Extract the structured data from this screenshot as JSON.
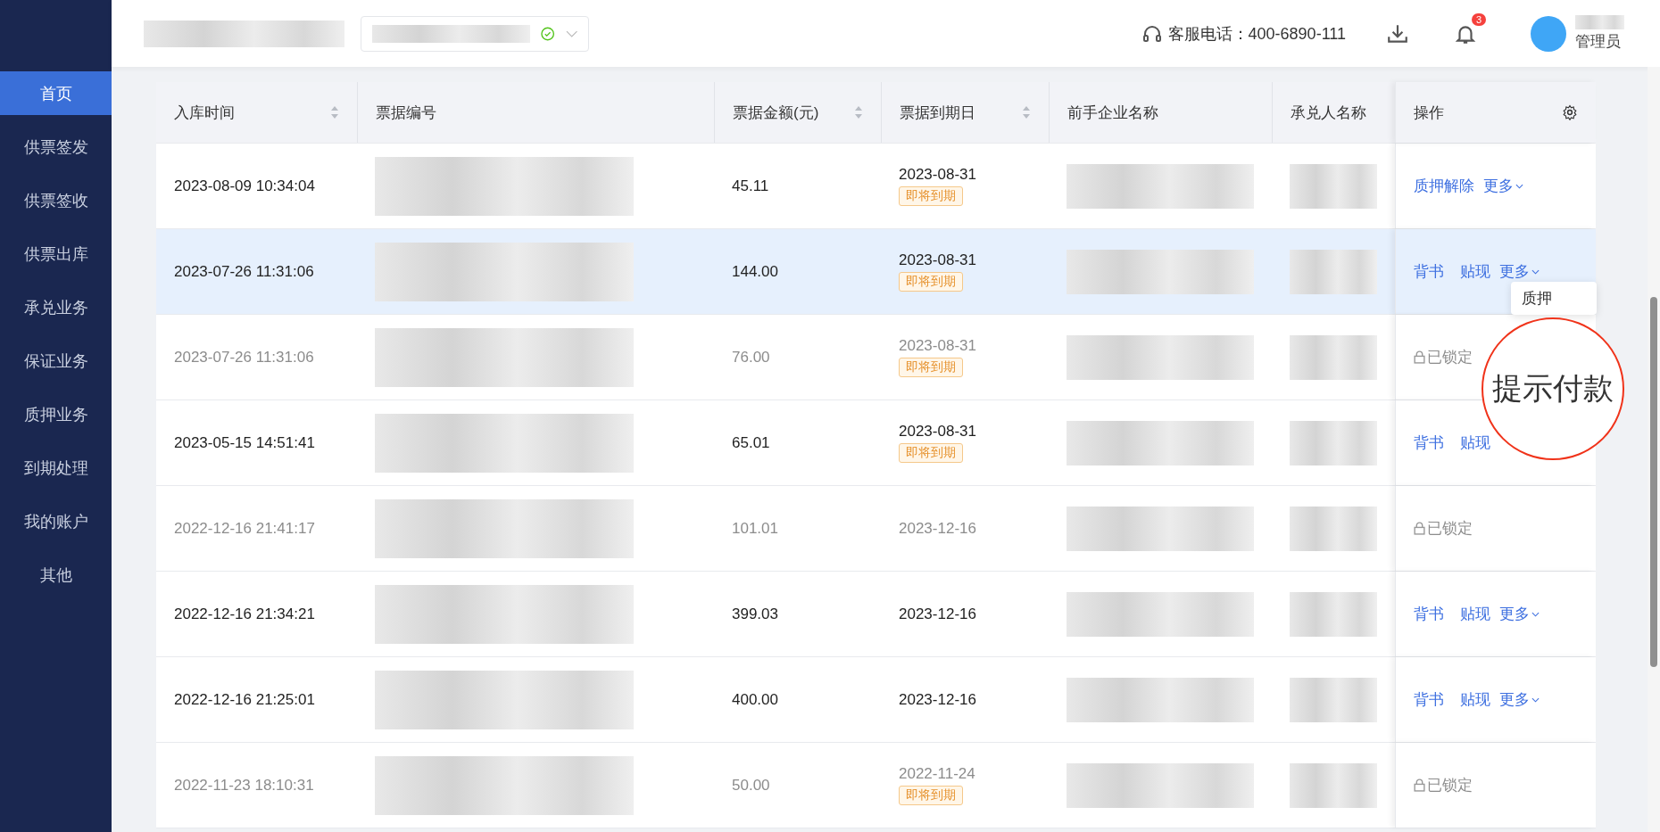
{
  "header": {
    "phone_label": "客服电话：400-6890-111",
    "notification_count": "3",
    "user_role": "管理员"
  },
  "sidebar": {
    "items": [
      {
        "label": "首页",
        "selected": true
      },
      {
        "label": "供票签发",
        "selected": false
      },
      {
        "label": "供票签收",
        "selected": false
      },
      {
        "label": "供票出库",
        "selected": false
      },
      {
        "label": "承兑业务",
        "selected": false
      },
      {
        "label": "保证业务",
        "selected": false
      },
      {
        "label": "质押业务",
        "selected": false
      },
      {
        "label": "到期处理",
        "selected": false
      },
      {
        "label": "我的账户",
        "selected": false
      },
      {
        "label": "其他",
        "selected": false
      }
    ]
  },
  "table": {
    "columns": [
      {
        "label": "入库时间",
        "sortable": true
      },
      {
        "label": "票据编号",
        "sortable": false
      },
      {
        "label": "票据金额(元)",
        "sortable": true
      },
      {
        "label": "票据到期日",
        "sortable": true
      },
      {
        "label": "前手企业名称",
        "sortable": false
      },
      {
        "label": "承兑人名称",
        "sortable": false
      },
      {
        "label": "操作",
        "sortable": false
      }
    ],
    "rows": [
      {
        "time": "2023-08-09 10:34:04",
        "amount": "45.11",
        "due": "2023-08-31",
        "badge": "即将到期",
        "locked": false,
        "selected": false,
        "actions": [
          "质押解除"
        ],
        "more": "更多"
      },
      {
        "time": "2023-07-26 11:31:06",
        "amount": "144.00",
        "due": "2023-08-31",
        "badge": "即将到期",
        "locked": false,
        "selected": true,
        "actions": [
          "背书",
          "贴现"
        ],
        "more": "更多"
      },
      {
        "time": "2023-07-26 11:31:06",
        "amount": "76.00",
        "due": "2023-08-31",
        "badge": "即将到期",
        "locked": true,
        "selected": false,
        "lock_label": "已锁定"
      },
      {
        "time": "2023-05-15 14:51:41",
        "amount": "65.01",
        "due": "2023-08-31",
        "badge": "即将到期",
        "locked": false,
        "selected": false,
        "actions": [
          "背书",
          "贴现"
        ]
      },
      {
        "time": "2022-12-16 21:41:17",
        "amount": "101.01",
        "due": "2023-12-16",
        "locked": true,
        "selected": false,
        "lock_label": "已锁定"
      },
      {
        "time": "2022-12-16 21:34:21",
        "amount": "399.03",
        "due": "2023-12-16",
        "locked": false,
        "selected": false,
        "actions": [
          "背书",
          "贴现"
        ],
        "more": "更多"
      },
      {
        "time": "2022-12-16 21:25:01",
        "amount": "400.00",
        "due": "2023-12-16",
        "locked": false,
        "selected": false,
        "actions": [
          "背书",
          "贴现"
        ],
        "more": "更多"
      },
      {
        "time": "2022-11-23 18:10:31",
        "amount": "50.00",
        "due": "2022-11-24",
        "badge": "即将到期",
        "locked": true,
        "selected": false,
        "lock_label": "已锁定"
      }
    ]
  },
  "dropdown": {
    "items": [
      "质押"
    ]
  },
  "magnifier": {
    "text": "提示付款"
  }
}
